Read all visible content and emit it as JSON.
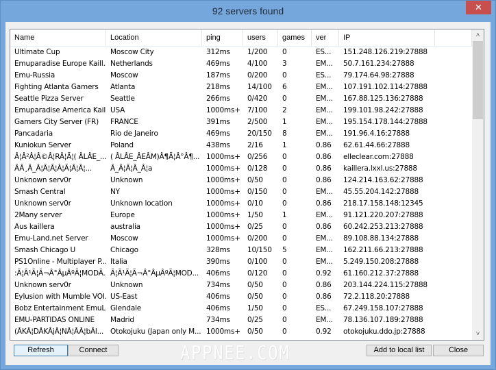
{
  "window": {
    "title": "92 servers found",
    "close_glyph": "✕"
  },
  "list": {
    "columns": [
      {
        "key": "name",
        "label": "Name"
      },
      {
        "key": "location",
        "label": "Location"
      },
      {
        "key": "ping",
        "label": "ping"
      },
      {
        "key": "users",
        "label": "users"
      },
      {
        "key": "games",
        "label": "games"
      },
      {
        "key": "ver",
        "label": "ver"
      },
      {
        "key": "ip",
        "label": "IP"
      }
    ],
    "rows": [
      {
        "name": "Ultimate Cup",
        "location": "Moscow City",
        "ping": "312ms",
        "users": "1/200",
        "games": "0",
        "ver": "ES...",
        "ip": "151.248.126.219:27888"
      },
      {
        "name": "Emuparadise Europe Kaill...",
        "location": "Netherlands",
        "ping": "469ms",
        "users": "4/100",
        "games": "3",
        "ver": "EM...",
        "ip": "50.7.161.234:27888"
      },
      {
        "name": "Emu-Russia",
        "location": "Moscow",
        "ping": "187ms",
        "users": "0/200",
        "games": "0",
        "ver": "ES...",
        "ip": "79.174.64.98:27888"
      },
      {
        "name": "Fighting Atlanta Gamers",
        "location": "Atlanta",
        "ping": "218ms",
        "users": "14/100",
        "games": "6",
        "ver": "EM...",
        "ip": "107.191.102.114:27888"
      },
      {
        "name": "Seattle Pizza Server",
        "location": "Seattle",
        "ping": "266ms",
        "users": "0/420",
        "games": "0",
        "ver": "EM...",
        "ip": "167.88.125.136:27888"
      },
      {
        "name": "Emuparadise America Kail...",
        "location": "USA",
        "ping": "1000ms+",
        "users": "7/100",
        "games": "2",
        "ver": "EM...",
        "ip": "199.101.98.242:27888"
      },
      {
        "name": "Gamers City Server (FR)",
        "location": "FRANCE",
        "ping": "391ms",
        "users": "2/500",
        "games": "1",
        "ver": "EM...",
        "ip": "195.154.178.144:27888"
      },
      {
        "name": "Pancadaria",
        "location": "Rio de Janeiro",
        "ping": "469ms",
        "users": "20/150",
        "games": "8",
        "ver": "EM...",
        "ip": "191.96.4.16:27888"
      },
      {
        "name": "Kuniokun Server",
        "location": "Poland",
        "ping": "438ms",
        "users": "2/16",
        "games": "1",
        "ver": "0.86",
        "ip": "62.61.44.66:27888"
      },
      {
        "name": "Â¦Â²Â¦Â©Â¦RÂ¦Ã¦( ÂLÂE_...",
        "location": "( ÂLÂE_ÂEÂM)Â¶Ã¦Â°Â¶...",
        "ping": "1000ms+",
        "users": "0/256",
        "games": "0",
        "ver": "0.86",
        "ip": "elleclear.com:27888"
      },
      {
        "name": "ÂÂ¸Â_Â¦Ã¦Â¦Â¦Ã¦Â¦Â¦...",
        "location": "Â_Â¦Ã¦Â_Â¦a",
        "ping": "1000ms+",
        "users": "0/128",
        "games": "0",
        "ver": "0.86",
        "ip": "kaillera.lxxl.us:27888"
      },
      {
        "name": "Unknown serv0r",
        "location": "Unknown",
        "ping": "1000ms+",
        "users": "0/50",
        "games": "0",
        "ver": "0.86",
        "ip": "124.214.163.62:27888"
      },
      {
        "name": "Smash Central",
        "location": "NY",
        "ping": "1000ms+",
        "users": "0/150",
        "games": "0",
        "ver": "EM...",
        "ip": "45.55.204.142:27888"
      },
      {
        "name": "Unknown serv0r",
        "location": "Unknown location",
        "ping": "1000ms+",
        "users": "0/10",
        "games": "0",
        "ver": "0.86",
        "ip": "218.17.158.148:12345"
      },
      {
        "name": "2Many server",
        "location": "Europe",
        "ping": "1000ms+",
        "users": "1/50",
        "games": "1",
        "ver": "EM...",
        "ip": "91.121.220.207:27888"
      },
      {
        "name": "Aus kaillera",
        "location": "australia",
        "ping": "1000ms+",
        "users": "0/25",
        "games": "0",
        "ver": "0.86",
        "ip": "60.242.253.213:27888"
      },
      {
        "name": "Emu-Land.net Server",
        "location": "Moscow",
        "ping": "1000ms+",
        "users": "0/200",
        "games": "0",
        "ver": "EM...",
        "ip": "89.108.88.134:27888"
      },
      {
        "name": "Smash Chicago U",
        "location": "Chicago",
        "ping": "328ms",
        "users": "10/150",
        "games": "5",
        "ver": "EM...",
        "ip": "162.211.66.213:27888"
      },
      {
        "name": "PS1Online - Multiplayer P...",
        "location": "Italia",
        "ping": "390ms",
        "users": "0/100",
        "games": "0",
        "ver": "EM...",
        "ip": "5.249.150.208:27888"
      },
      {
        "name": ":Ã¦Ã¹Ã¦Ã¬Â°ÂµÂºÃ¦MODÃ...",
        "location": "Ã¦Ã¹Ã¦Ã¬Â°ÂµÂºÃ¦MOD...",
        "ping": "406ms",
        "users": "0/120",
        "games": "0",
        "ver": "0.92",
        "ip": "61.160.212.37:27888"
      },
      {
        "name": "Unknown serv0r",
        "location": "Unknown",
        "ping": "734ms",
        "users": "0/50",
        "games": "0",
        "ver": "0.86",
        "ip": "203.144.224.115:27888"
      },
      {
        "name": "Eylusion with Mumble VOI...",
        "location": "US-East",
        "ping": "406ms",
        "users": "0/50",
        "games": "0",
        "ver": "0.86",
        "ip": "72.2.118.20:27888"
      },
      {
        "name": "Bobz Entertainment EmuL...",
        "location": "Glendale",
        "ping": "406ms",
        "users": "1/50",
        "games": "0",
        "ver": "ES...",
        "ip": "67.249.158.107:27888"
      },
      {
        "name": "EMU-PARTIDAS ONLINE",
        "location": "Madrid",
        "ping": "734ms",
        "users": "0/25",
        "games": "0",
        "ver": "EM...",
        "ip": "78.136.107.189:27888"
      },
      {
        "name": "(ÂKÂ¦DÂKÂjÂ¦NÂ¦ÂÂ¦bÂl...",
        "location": "Otokojuku (Japan only M...",
        "ping": "1000ms+",
        "users": "0/50",
        "games": "0",
        "ver": "0.92",
        "ip": "otokojuku.ddo.jp:27888"
      }
    ],
    "scroll_up_glyph": "˄",
    "scroll_down_glyph": "˅"
  },
  "buttons": {
    "refresh": "Refresh",
    "connect": "Connect",
    "add_to_local": "Add to local list",
    "close": "Close"
  },
  "watermark": "APPNEE.COM"
}
